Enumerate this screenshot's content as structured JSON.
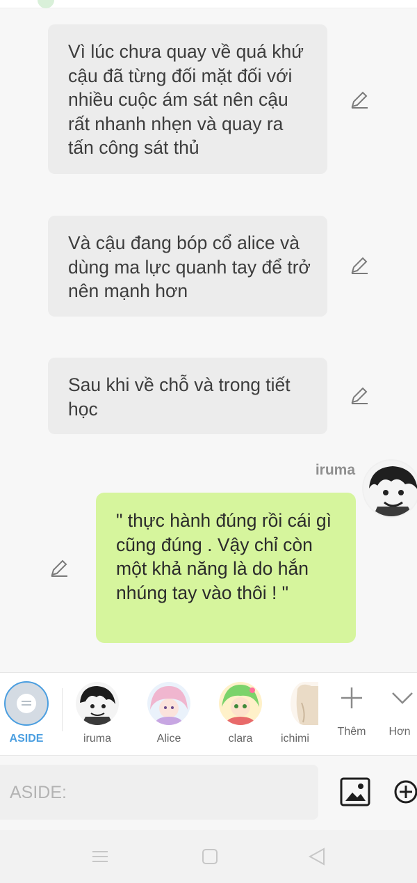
{
  "messages": [
    {
      "side": "left",
      "text": "Vì lúc chưa quay về quá khứ cậu đã từng đối mặt đối với nhiều cuộc ám sát nên cậu rất nhanh nhẹn và quay ra tấn công sát thủ"
    },
    {
      "side": "left",
      "text": "Và cậu đang bóp cổ alice và dùng ma lực quanh tay để trở nên mạnh hơn"
    },
    {
      "side": "left",
      "text": "Sau khi về chỗ và trong tiết học"
    },
    {
      "side": "right",
      "sender": "iruma",
      "text": "\" thực hành đúng rồi cái gì cũng đúng . Vậy chỉ còn một khả năng là do hắn nhúng tay vào thôi ! \""
    }
  ],
  "characters": [
    {
      "label": "ASIDE",
      "selected": true,
      "color": "#4a9ee0"
    },
    {
      "label": "iruma"
    },
    {
      "label": "Alice"
    },
    {
      "label": "clara"
    },
    {
      "label": "ichimi"
    }
  ],
  "actions": {
    "add_label": "Thêm",
    "more_label": "Hơn"
  },
  "composer": {
    "placeholder": "ASIDE:"
  },
  "icons": {
    "edit": "pencil-icon",
    "image": "image-icon",
    "plus": "plus-circle-icon",
    "nav_menu": "menu-icon",
    "nav_home": "home-square-icon",
    "nav_back": "back-triangle-icon"
  },
  "colors": {
    "accent": "#4a9ee0",
    "right_bubble": "#d6f59d",
    "left_bubble": "#ececec"
  }
}
